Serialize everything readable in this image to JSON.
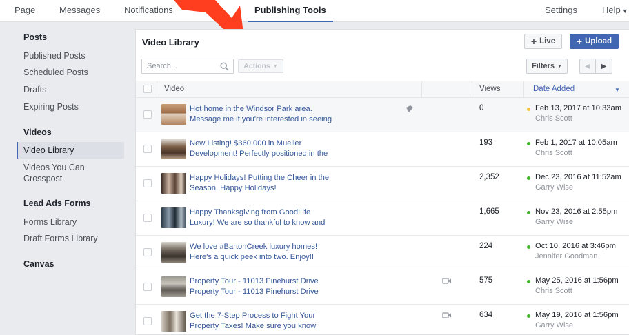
{
  "topnav": {
    "page": "Page",
    "messages": "Messages",
    "notifications": "Notifications",
    "publishing_tools": "Publishing Tools",
    "settings": "Settings",
    "help": "Help"
  },
  "sidebar": {
    "posts_heading": "Posts",
    "published_posts": "Published Posts",
    "scheduled_posts": "Scheduled Posts",
    "drafts": "Drafts",
    "expiring_posts": "Expiring Posts",
    "videos_heading": "Videos",
    "video_library": "Video Library",
    "videos_crosspost_1": "Videos You Can",
    "videos_crosspost_2": "Crosspost",
    "lead_ads_heading": "Lead Ads Forms",
    "forms_library": "Forms Library",
    "draft_forms_library": "Draft Forms Library",
    "canvas_heading": "Canvas"
  },
  "panel": {
    "title": "Video Library",
    "live_label": "Live",
    "upload_label": "Upload",
    "search_placeholder": "Search...",
    "actions_label": "Actions",
    "filters_label": "Filters"
  },
  "table": {
    "col_video": "Video",
    "col_views": "Views",
    "col_date": "Date Added"
  },
  "rows": [
    {
      "title": "Hot home in the Windsor Park area. Message me if you're interested in seeing this...",
      "views": "0",
      "date": "Feb 13, 2017 at 10:33am",
      "author": "Chris Scott"
    },
    {
      "title": "New Listing! $360,000 in Mueller Development! Perfectly positioned in the heart o...",
      "views": "193",
      "date": "Feb 1, 2017 at 10:05am",
      "author": "Chris Scott"
    },
    {
      "title": "Happy Holidays! Putting the Cheer in the Season. Happy Holidays!",
      "views": "2,352",
      "date": "Dec 23, 2016 at 11:52am",
      "author": "Garry Wise"
    },
    {
      "title": "Happy Thanksgiving from GoodLife Luxury! We are so thankful to know and share...",
      "views": "1,665",
      "date": "Nov 23, 2016 at 2:55pm",
      "author": "Garry Wise"
    },
    {
      "title": "We love #BartonCreek luxury homes! Here's a quick peek into two. Enjoy!!",
      "views": "224",
      "date": "Oct 10, 2016 at 3:46pm",
      "author": "Jennifer Goodman"
    },
    {
      "title": "Property Tour - 11013 Pinehurst Drive Property Tour - 11013 Pinehurst Drive",
      "views": "575",
      "date": "May 25, 2016 at 1:56pm",
      "author": "Chris Scott"
    },
    {
      "title": "Get the 7-Step Process to Fight Your Property Taxes! Make sure you know HOW t...",
      "views": "634",
      "date": "May 19, 2016 at 1:56pm",
      "author": "Garry Wise"
    }
  ],
  "colors": {
    "accent": "#4267b2",
    "link": "#365899",
    "arrow": "#ff3d1f",
    "status_scheduled": "#f5c33b",
    "status_published": "#42b72a"
  },
  "icons": {
    "search": "search-icon",
    "edit_badge": "pencil-badge-icon",
    "crossposted": "video-camera-icon",
    "plus": "plus-icon",
    "caret": "caret-down-icon"
  }
}
